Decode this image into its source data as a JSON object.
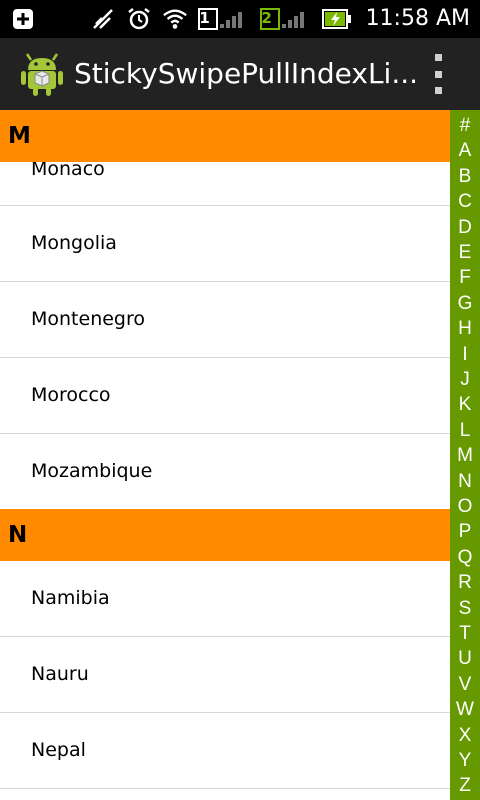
{
  "status_bar": {
    "time": "11:58 AM",
    "sim1_label": "1",
    "sim2_label": "2"
  },
  "action_bar": {
    "title": "StickySwipePullIndexLi..."
  },
  "list": {
    "sections": [
      {
        "header": "M",
        "items": [
          "Monaco",
          "Mongolia",
          "Montenegro",
          "Morocco",
          "Mozambique"
        ]
      },
      {
        "header": "N",
        "items": [
          "Namibia",
          "Nauru",
          "Nepal"
        ]
      }
    ]
  },
  "index_bar": {
    "letters": [
      "#",
      "A",
      "B",
      "C",
      "D",
      "E",
      "F",
      "G",
      "H",
      "I",
      "J",
      "K",
      "L",
      "M",
      "N",
      "O",
      "P",
      "Q",
      "R",
      "S",
      "T",
      "U",
      "V",
      "W",
      "X",
      "Y",
      "Z"
    ]
  },
  "colors": {
    "section_header_bg": "#ff8a00",
    "index_bar_bg": "#669900",
    "action_bar_bg": "#222222",
    "status_bar_bg": "#000000"
  }
}
